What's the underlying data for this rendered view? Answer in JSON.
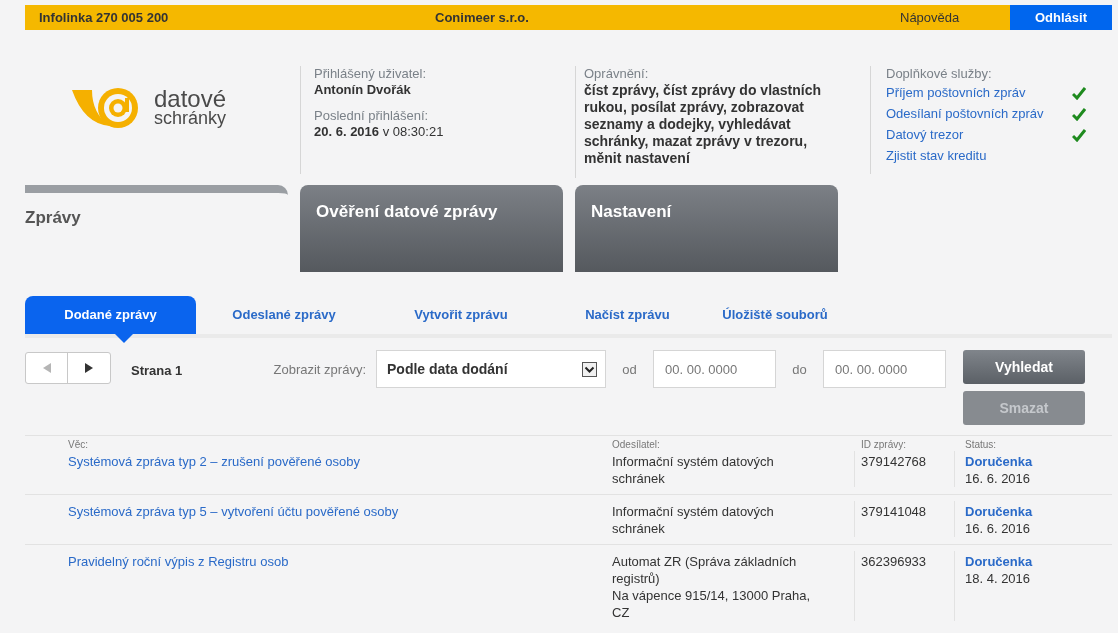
{
  "top_bar": {
    "hotline": "Infolinka 270 005 200",
    "company": "Conimeer s.r.o.",
    "help": "Nápověda",
    "logout": "Odhlásit"
  },
  "logo": {
    "line1": "datové",
    "line2": "schránky"
  },
  "user": {
    "label": "Přihlášený uživatel:",
    "name": "Antonín Dvořák",
    "last_login_label": "Poslední přihlášení:",
    "last_login": "**20. 6. 2016** v 08:30:21"
  },
  "permissions": {
    "label": "Oprávnění:",
    "text": "číst zprávy, číst zprávy do vlastních rukou, posílat zprávy, zobrazovat seznamy a dodejky, vyhledávat schránky, mazat zprávy v trezoru, měnit nastavení"
  },
  "services": {
    "label": "Doplňkové služby:",
    "items": [
      {
        "label": "Příjem poštovních zpráv",
        "checked": true
      },
      {
        "label": "Odesílaní poštovních zpráv",
        "checked": true
      },
      {
        "label": "Datový trezor",
        "checked": true
      },
      {
        "label": "Zjistit stav kreditu",
        "checked": false
      }
    ]
  },
  "main_tabs": [
    {
      "label": "Zprávy",
      "selected": true
    },
    {
      "label": "Ověření datové zprávy",
      "selected": false
    },
    {
      "label": "Nastavení",
      "selected": false
    }
  ],
  "sub_tabs": [
    {
      "label": "Dodané zprávy",
      "selected": true
    },
    {
      "label": "Odeslané zprávy",
      "selected": false
    },
    {
      "label": "Vytvořit zprávu",
      "selected": false
    },
    {
      "label": "Načíst zprávu",
      "selected": false
    },
    {
      "label": "Úložiště souborů",
      "selected": false
    }
  ],
  "toolbar": {
    "page": "Strana 1",
    "filter_label": "Zobrazit zprávy:",
    "filter_value": "Podle data dodání",
    "from_label": "od",
    "from_placeholder": "00. 00. 0000",
    "to_label": "do",
    "to_placeholder": "00. 00. 0000"
  },
  "buttons": [
    {
      "label": "Vyhledat",
      "disabled": false
    },
    {
      "label": "Smazat",
      "disabled": true
    }
  ],
  "table": {
    "columns": [
      "Věc:",
      "Odesílatel:",
      "ID zprávy:",
      "Status:"
    ],
    "rows": [
      {
        "subject": "Systémová zpráva typ 2 – zrušení pověřené osoby",
        "sender": "Informační systém datových schránek",
        "id": "379142768",
        "status": "Doručenka",
        "date": "16. 6. 2016"
      },
      {
        "subject": "Systémová zpráva typ 5 – vytvoření účtu pověřené osoby",
        "sender": "Informační systém datových schránek",
        "id": "379141048",
        "status": "Doručenka",
        "date": "16. 6. 2016"
      },
      {
        "subject": "Pravidelný roční výpis z Registru osob",
        "sender": "Automat ZR (Správa základních registrů)\nNa vápence 915/14, 13000 Praha, CZ",
        "id": "362396933",
        "status": "Doručenka",
        "date": "18. 4. 2016"
      }
    ]
  }
}
